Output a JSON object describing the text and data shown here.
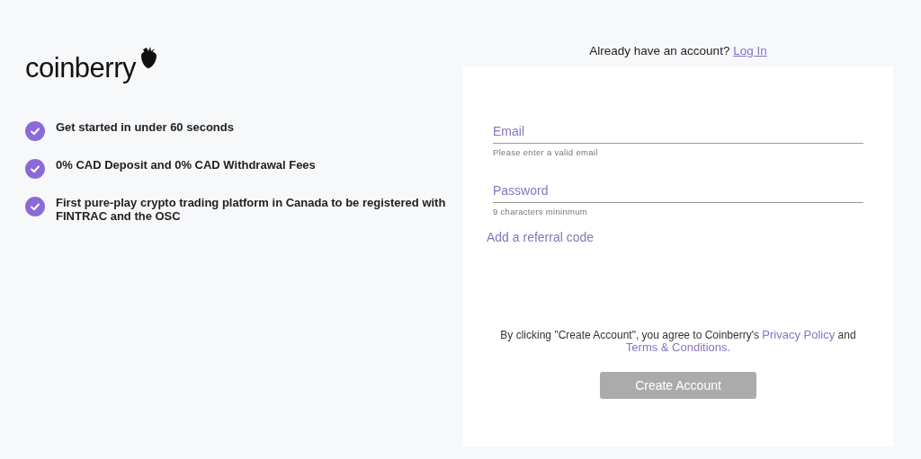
{
  "logo": {
    "text": "coinberry"
  },
  "features": [
    "Get started in under 60 seconds",
    "0% CAD Deposit and 0% CAD Withdrawal Fees",
    "First pure-play crypto trading platform in Canada to be registered with FINTRAC and the OSC"
  ],
  "login_prompt": {
    "text": "Already have an account?",
    "link": "Log In"
  },
  "form": {
    "fields": [
      {
        "placeholder": "Email",
        "hint": "Please enter a valid email"
      },
      {
        "placeholder": "Password",
        "hint": "9 characters mininmum"
      }
    ],
    "referral_link": "Add a referral code",
    "legal": {
      "before": "By clicking \"Create Account\", you agree to Coinberry's",
      "privacy_link": "Privacy Policy",
      "middle": "and",
      "terms_link": "Terms & Conditions."
    },
    "submit": {
      "label": "Create Account",
      "disabled": true
    }
  }
}
